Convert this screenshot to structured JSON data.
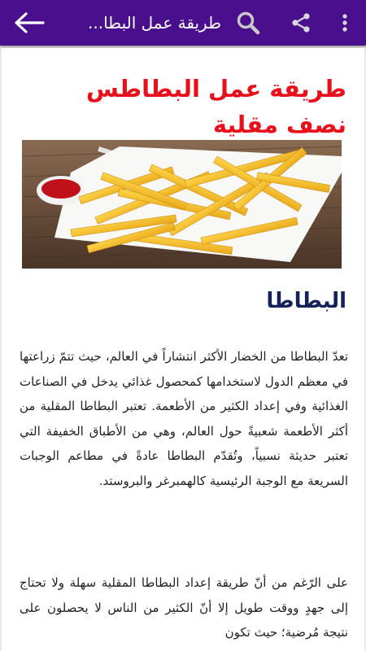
{
  "appbar": {
    "title": "طريقة عمل البطا...",
    "background": "#4a0f8c",
    "icons": {
      "back": "arrow-left-icon",
      "search": "search-icon",
      "share": "share-icon",
      "menu": "more-vertical-icon"
    }
  },
  "article": {
    "title": "طريقة عمل البطاطس نصف مقلية",
    "title_color": "#e8101b",
    "image": "french-fries-plate-with-ketchup",
    "section_heading": "البطاطا",
    "paragraphs": [
      "تعدّ البطاطا من الخضار الأكثر انتشاراً في العالم، حيث تتمّ زراعتها في معظم الدول لاستخدامها كمحصول غذائي يدخل في الصناعات الغذائية وفي إعداد الكثير من الأطعمة. تعتبر البطاطا المقلية من أكثر الأطعمة شعبيةً حول العالم، وهي من الأطباق الخفيفة التي تعتبر حديثة نسبياً، وتُقدّم البطاطا عادةً في مطاعم الوجبات السريعة مع الوجبة الرئيسية كالهمبرغر والبروستد.",
      "على الرّغم من أنّ طريقة إعداد البطاطا المقلية سهلة ولا تحتاج إلى جهدٍ ووقت طويل إلا أنّ الكثير من الناس لا يحصلون على نتيجة مُرضية؛ حيث تكون"
    ]
  }
}
